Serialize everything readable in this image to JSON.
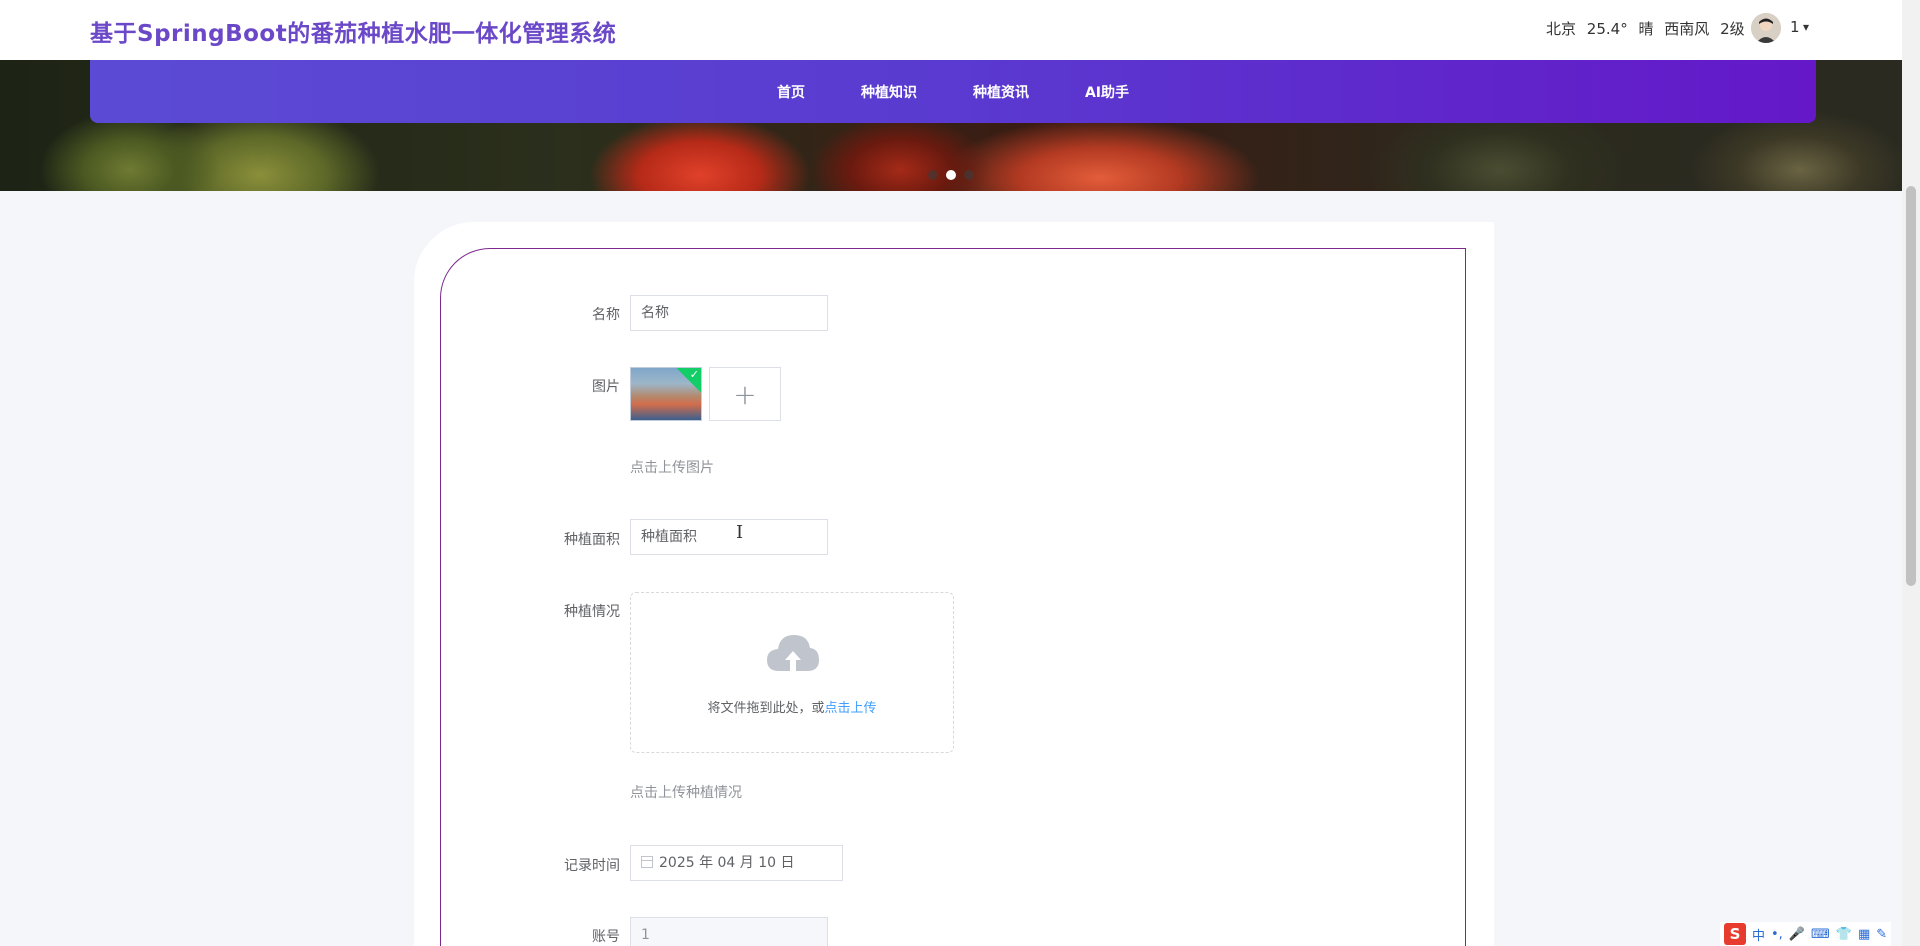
{
  "header": {
    "title": "基于SpringBoot的番茄种植水肥一体化管理系统",
    "weather": {
      "city": "北京",
      "temp": "25.4°",
      "condition": "晴",
      "wind": "西南风",
      "level": "2级"
    },
    "user": {
      "name": "1",
      "caret": "▾"
    }
  },
  "nav": {
    "items": [
      "首页",
      "种植知识",
      "种植资讯",
      "AI助手"
    ]
  },
  "banner": {
    "slide_count": 3,
    "active_slide": 2
  },
  "form": {
    "name": {
      "label": "名称",
      "placeholder": "名称"
    },
    "image": {
      "label": "图片",
      "hint": "点击上传图片",
      "add_icon": "+",
      "check_icon": "✓"
    },
    "area": {
      "label": "种植面积",
      "placeholder": "种植面积"
    },
    "situation": {
      "label": "种植情况",
      "drop_text": "将文件拖到此处，或",
      "drop_link": "点击上传",
      "hint": "点击上传种植情况"
    },
    "record_time": {
      "label": "记录时间",
      "value": "2025 年 04 月 10 日"
    },
    "account": {
      "label": "账号",
      "value": "1"
    }
  },
  "ime": {
    "brand": "S",
    "icons": [
      "中",
      "•,",
      "🎤",
      "⌨",
      "👕",
      "▦",
      "✎"
    ]
  },
  "colors": {
    "title": "#6a48c8",
    "nav_start": "#5b4bd4",
    "nav_end": "#6418c8",
    "card_border": "#7b2a8c",
    "link": "#409eff",
    "success": "#13ce66"
  }
}
